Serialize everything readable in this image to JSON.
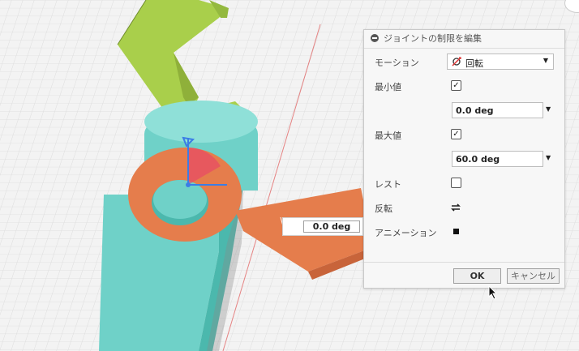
{
  "dialog": {
    "title": "ジョイントの制限を編集",
    "motion": {
      "label": "モーション",
      "value": "回転",
      "icon": "rotate-joint-icon"
    },
    "minimum": {
      "label": "最小値",
      "checked": true,
      "value": "0.0 deg"
    },
    "maximum": {
      "label": "最大値",
      "checked": true,
      "value": "60.0 deg"
    },
    "rest": {
      "label": "レスト",
      "checked": false
    },
    "flip": {
      "label": "反転",
      "icon": "flip-arrows-icon"
    },
    "animation": {
      "label": "アニメーション",
      "icon": "stop-square-icon"
    },
    "ok_label": "OK",
    "cancel_label": "キャンセル"
  },
  "viewport": {
    "angle_input": "0.0 deg"
  },
  "colors": {
    "link_green": "#a9cf4b",
    "link_cyan": "#6fd1c8",
    "arm_orange": "#e57d4c",
    "range_arc": "#e8406a",
    "grid_bg": "#f3f3f3"
  }
}
